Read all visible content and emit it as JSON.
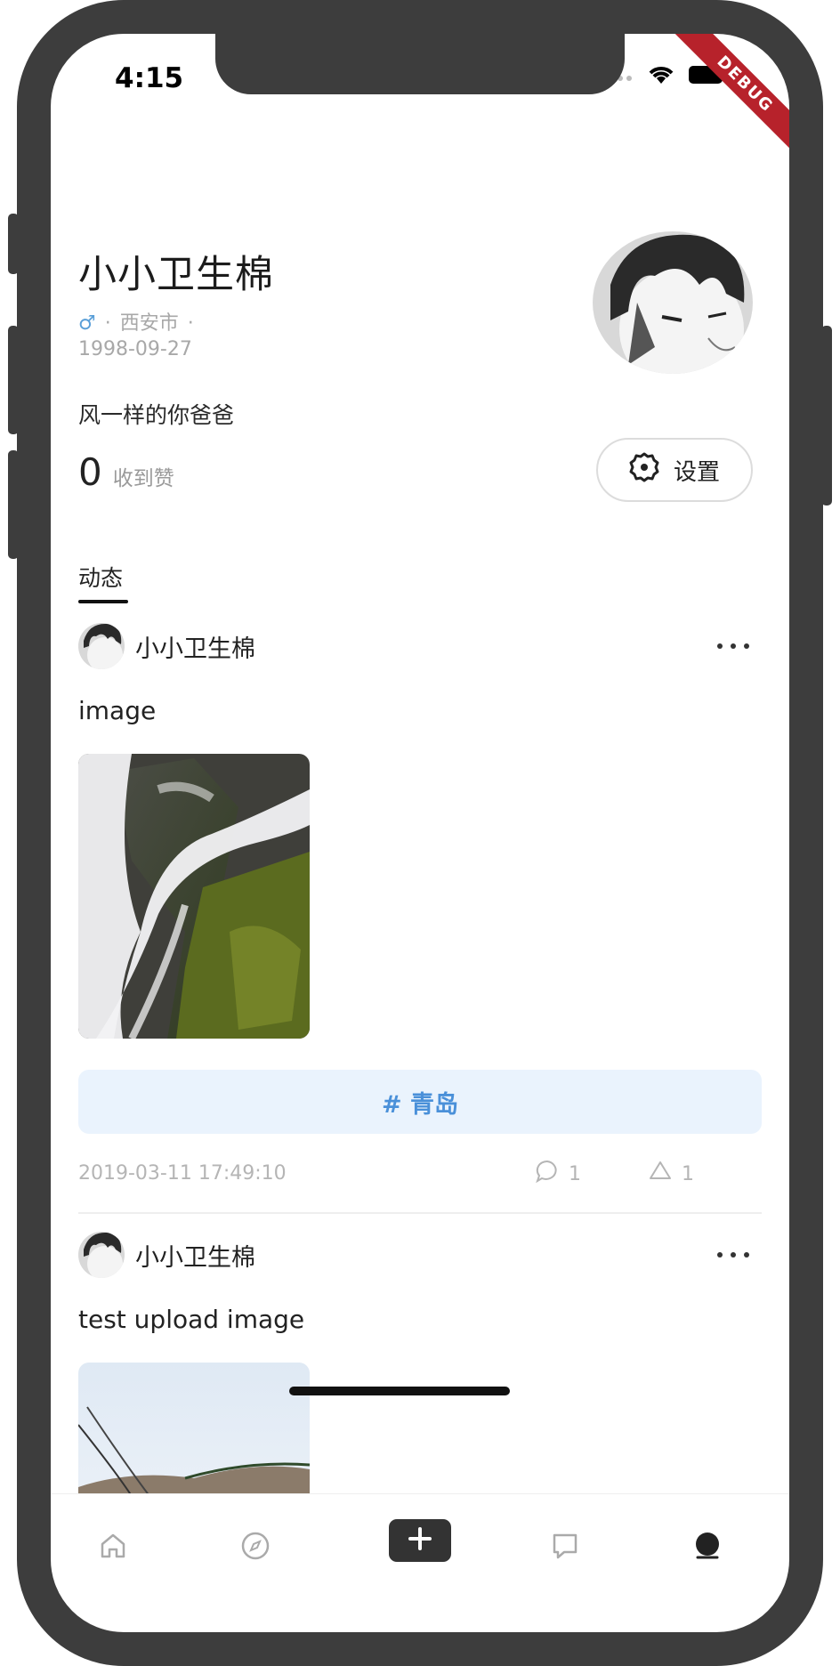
{
  "status_bar": {
    "time": "4:15",
    "debug_label": "DEBUG"
  },
  "profile": {
    "name": "小小卫生棉",
    "gender_symbol": "♂",
    "separator": "·",
    "city": "西安市",
    "birthday": "1998-09-27",
    "bio": "风一样的你爸爸",
    "likes_count": "0",
    "likes_label": "收到赞",
    "settings_label": "设置"
  },
  "tabs": [
    {
      "label": "动态",
      "active": true
    }
  ],
  "posts": [
    {
      "author": "小小卫生棉",
      "text": "image",
      "topic": "# 青岛",
      "date": "2019-03-11 17:49:10",
      "comments": "1",
      "likes": "1"
    },
    {
      "author": "小小卫生棉",
      "text": "test upload image"
    }
  ],
  "bottom_nav": [
    {
      "name": "home",
      "icon": "home-icon"
    },
    {
      "name": "discover",
      "icon": "compass-icon"
    },
    {
      "name": "publish",
      "icon": "plus-icon"
    },
    {
      "name": "messages",
      "icon": "chat-icon"
    },
    {
      "name": "profile",
      "icon": "user-icon",
      "active": true
    }
  ],
  "colors": {
    "topic_bg": "#eaf3fd",
    "topic_text": "#4a90d9",
    "debug": "#b7222b",
    "frame": "#3d3d3d"
  }
}
